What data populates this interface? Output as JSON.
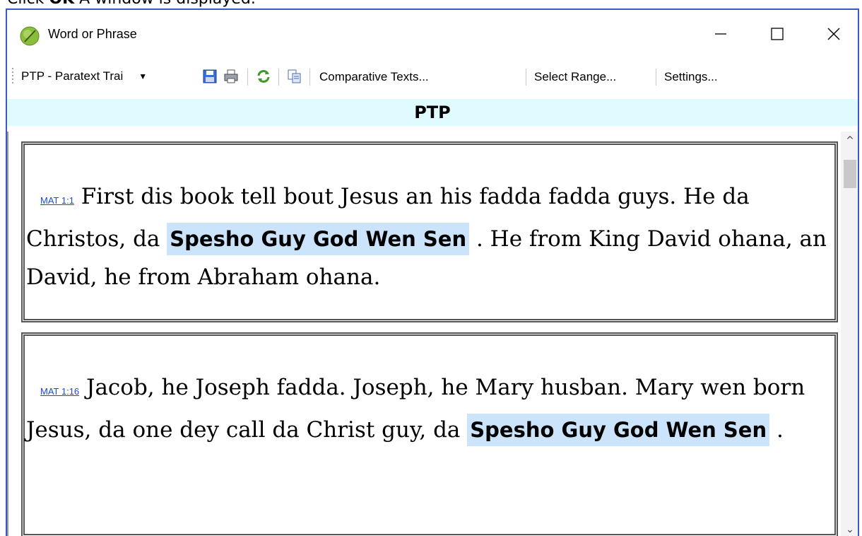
{
  "caption": {
    "prefix": "Click ",
    "bold": "OK",
    "suffix": " A window is displayed."
  },
  "window": {
    "title": "Word or Phrase"
  },
  "toolbar": {
    "project": "PTP - Paratext Trai",
    "comparative_texts": "Comparative Texts...",
    "select_range": "Select Range...",
    "settings": "Settings..."
  },
  "header": "PTP",
  "verses": [
    {
      "ref": "MAT 1:1",
      "before": " First dis book tell bout Jesus an his fadda fadda guys. He da Christos, da ",
      "highlight": "Spesho Guy God Wen Sen",
      "after": " . He from King David ohana, an David, he from Abraham ohana."
    },
    {
      "ref": "MAT 1:16",
      "before": " Jacob, he Joseph fadda. Joseph, he Mary husban. Mary wen born Jesus, da one dey call da Christ guy, da ",
      "highlight": "Spesho Guy God Wen Sen",
      "after": " ."
    }
  ]
}
